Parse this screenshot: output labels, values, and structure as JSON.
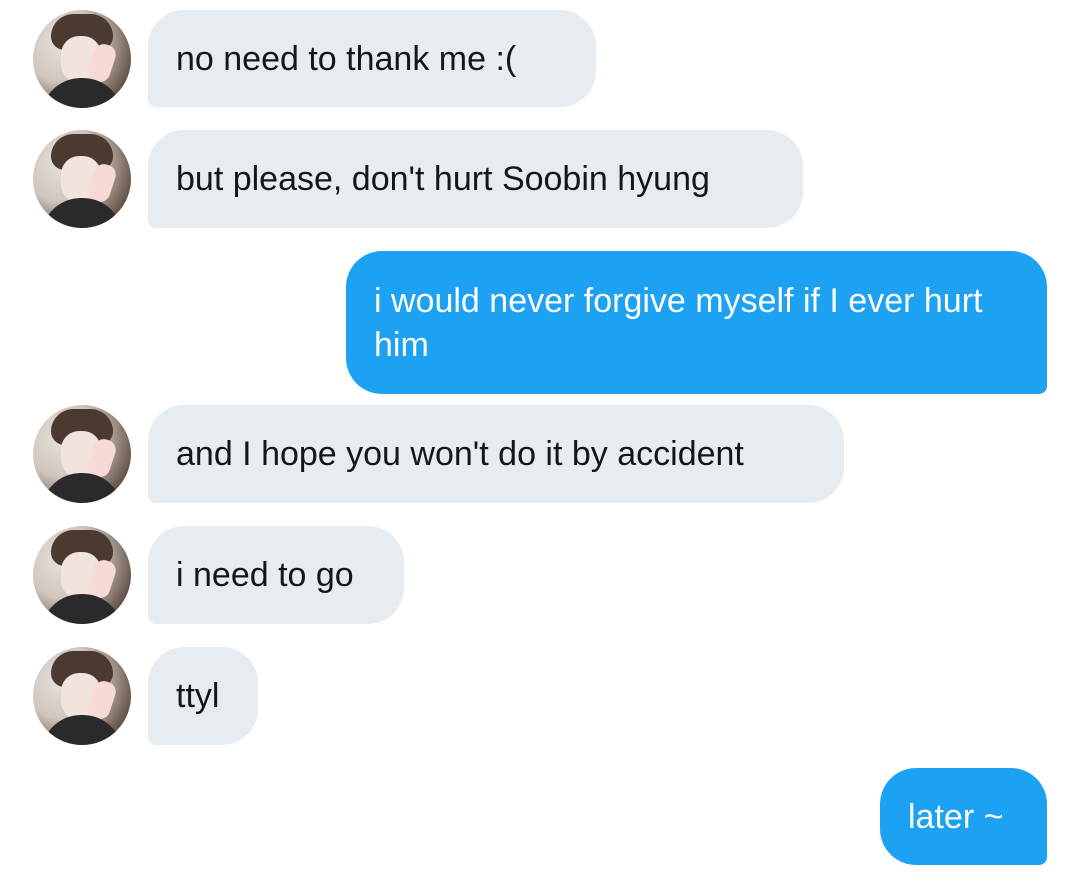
{
  "messages": [
    {
      "side": "in",
      "text": "no need to thank me :("
    },
    {
      "side": "in",
      "text": "but please, don't hurt Soobin hyung"
    },
    {
      "side": "out",
      "text": "i would never forgive myself if I ever hurt him"
    },
    {
      "side": "in",
      "text": "and I hope you won't do it by accident"
    },
    {
      "side": "in",
      "text": "i need to go"
    },
    {
      "side": "in",
      "text": "ttyl"
    },
    {
      "side": "out",
      "text": "later ~"
    }
  ],
  "colors": {
    "incoming_bubble": "#e6ecf0",
    "incoming_text": "#14171a",
    "outgoing_bubble": "#1da1f2",
    "outgoing_text": "#ffffff"
  }
}
